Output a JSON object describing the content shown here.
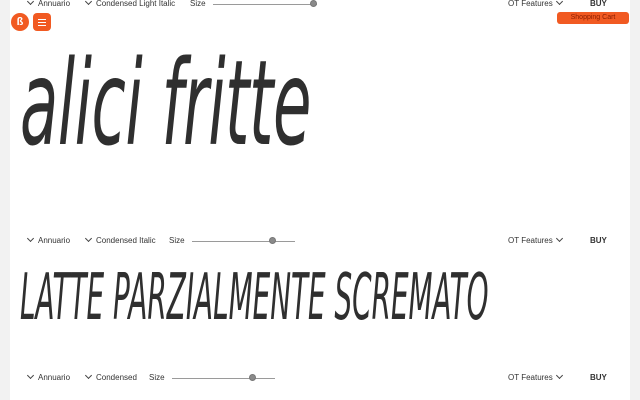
{
  "brand": {
    "logo_glyph": "ß",
    "accent_color": "#f15a22"
  },
  "header": {
    "cart_label": "Shopping Cart"
  },
  "testers": [
    {
      "family": "Annuario",
      "style": "Condensed Light Italic",
      "size_label": "Size",
      "size_level": 1.0,
      "ot_label": "OT Features",
      "buy_label": "BUY",
      "sample": "alici fritte"
    },
    {
      "family": "Annuario",
      "style": "Condensed Italic",
      "size_label": "Size",
      "size_level": 0.8,
      "ot_label": "OT Features",
      "buy_label": "BUY",
      "sample": "LATTE PARZIALMENTE SCREMATO"
    },
    {
      "family": "Annuario",
      "style": "Condensed",
      "size_label": "Size",
      "size_level": 0.8,
      "ot_label": "OT Features",
      "buy_label": "BUY"
    }
  ]
}
